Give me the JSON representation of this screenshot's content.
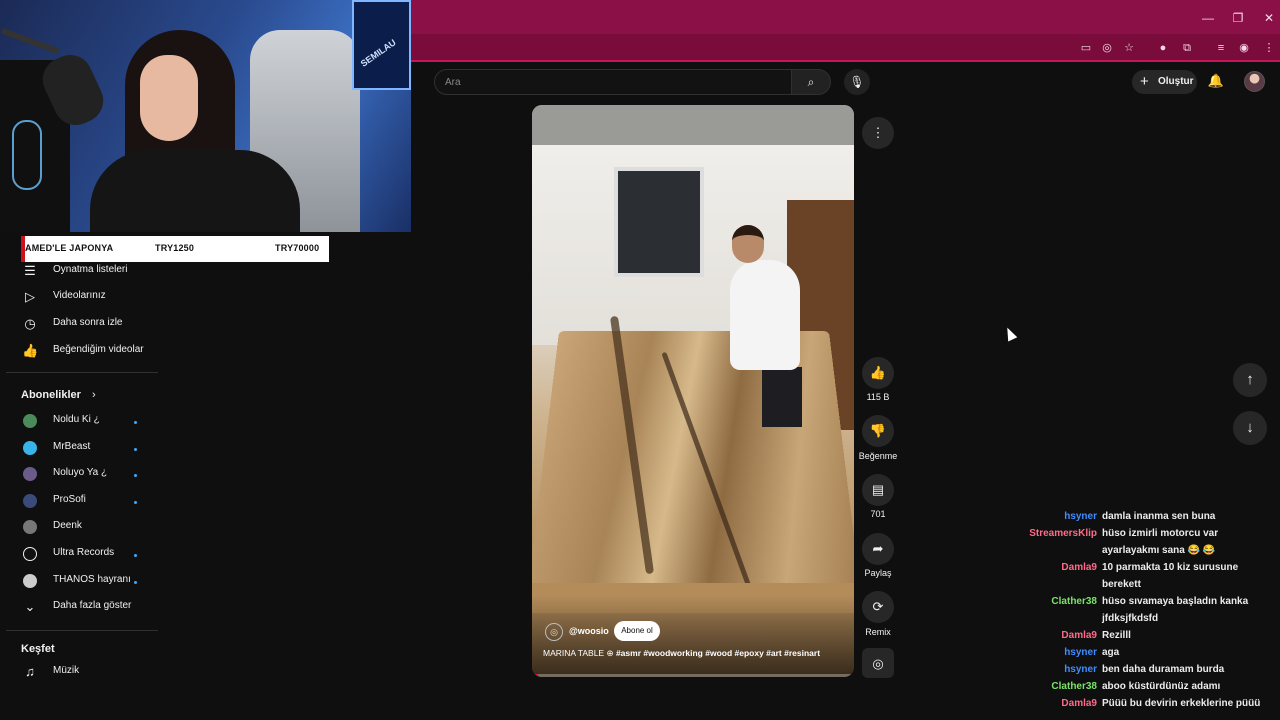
{
  "browser": {
    "window_controls": [
      "—",
      "❐",
      "✕"
    ],
    "color": "#8c1048"
  },
  "stream_overlay": {
    "logo_text": "SEMILAU",
    "ticker": {
      "left": "AMED'LE JAPONYA",
      "mid": "TRY1250",
      "right": "TRY70000"
    }
  },
  "sidebar": {
    "you_items": [
      {
        "label": "Oynatma listeleri",
        "icon": "playlist-icon"
      },
      {
        "label": "Videolarınız",
        "icon": "your-videos-icon"
      },
      {
        "label": "Daha sonra izle",
        "icon": "clock-icon"
      },
      {
        "label": "Beğendiğim videolar",
        "icon": "thumbs-up-icon"
      }
    ],
    "subs_title": "Abonelikler",
    "subscriptions": [
      {
        "label": "Noldu Ki ¿",
        "color": "#4b8a5a",
        "dot": true
      },
      {
        "label": "MrBeast",
        "color": "#37b5e8",
        "dot": true
      },
      {
        "label": "Noluyo Ya ¿",
        "color": "#6b5b8a",
        "dot": true
      },
      {
        "label": "ProSofi",
        "color": "#3a4a7a",
        "dot": true
      },
      {
        "label": "Deenk",
        "color": "#777777",
        "dot": false
      },
      {
        "label": "Ultra Records",
        "color": "#111111",
        "dot": true
      },
      {
        "label": "THANOS hayranı",
        "color": "#cccccc",
        "dot": true
      }
    ],
    "show_more": "Daha fazla göster",
    "explore_title": "Keşfet",
    "explore_items": [
      {
        "label": "Müzik",
        "icon": "music-icon"
      }
    ]
  },
  "header": {
    "search_placeholder": "Ara",
    "create_label": "Oluştur"
  },
  "short": {
    "channel": "@woosio",
    "subscribe_label": "Abone ol",
    "caption_title": "MARINA TABLE",
    "caption_tags": "#asmr #woodworking #wood #epoxy #art #resinart",
    "likes": "115 B",
    "dislike_label": "Beğenme",
    "comments": "701",
    "share_label": "Paylaş",
    "remix_label": "Remix",
    "progress_fraction": 0.02
  },
  "chat": [
    {
      "user": "hsyner",
      "color": "#3f8cff",
      "msg": "damla inanma sen buna"
    },
    {
      "user": "StreamersKlip",
      "color": "#ff6b8a",
      "msg": "hüso izmirli motorcu var ayarlayakmı sana 😂 😂"
    },
    {
      "user": "Damla9",
      "color": "#ff6b8a",
      "msg": "10 parmakta 10 kiz surusune berekett"
    },
    {
      "user": "Clather38",
      "color": "#7be36a",
      "msg": "hüso sıvamaya başladın kanka jfdksjfkdsfd"
    },
    {
      "user": "Damla9",
      "color": "#ff6b8a",
      "msg": "Rezilll"
    },
    {
      "user": "hsyner",
      "color": "#3f8cff",
      "msg": "aga"
    },
    {
      "user": "hsyner",
      "color": "#3f8cff",
      "msg": "ben daha duramam burda"
    },
    {
      "user": "Clather38",
      "color": "#7be36a",
      "msg": "aboo küstürdünüz adamı"
    },
    {
      "user": "Damla9",
      "color": "#ff6b8a",
      "msg": "Püüü bu devirin erkeklerine püüü"
    }
  ]
}
